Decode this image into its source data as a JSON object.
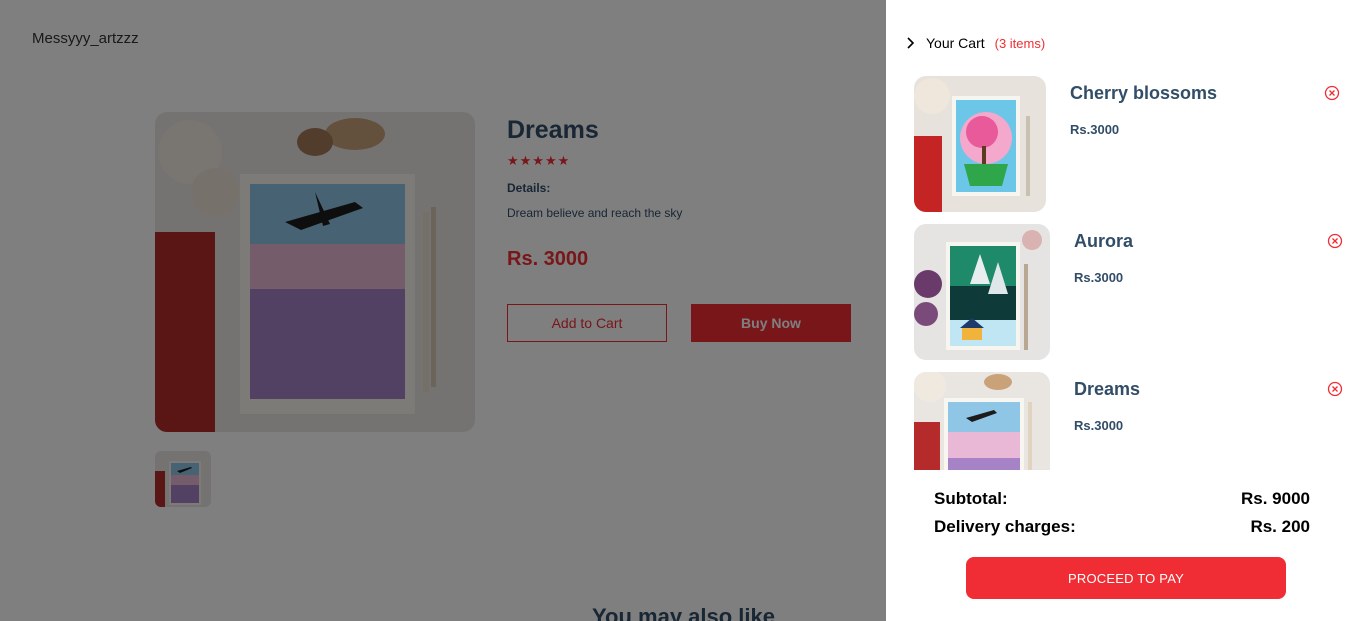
{
  "brand": "Messyyy_artzzz",
  "product": {
    "title": "Dreams",
    "stars": "★★★★★",
    "details_heading": "Details:",
    "details": "Dream believe and reach the sky",
    "price": "Rs. 3000",
    "add_to_cart": "Add to Cart",
    "buy_now": "Buy Now"
  },
  "section_title": "You may also like",
  "cart": {
    "title": "Your Cart",
    "count": "(3 items)",
    "items": [
      {
        "name": "Cherry blossoms",
        "price": "Rs.3000"
      },
      {
        "name": "Aurora",
        "price": "Rs.3000"
      },
      {
        "name": "Dreams",
        "price": "Rs.3000"
      }
    ],
    "subtotal_label": "Subtotal:",
    "subtotal_value": "Rs. 9000",
    "delivery_label": "Delivery charges:",
    "delivery_value": "Rs. 200",
    "pay_label": "PROCEED TO PAY"
  },
  "icons": {
    "back": "chevron-right-icon",
    "remove": "close-circle-icon"
  },
  "colors": {
    "accent": "#f02d34",
    "heading": "#324d67"
  }
}
